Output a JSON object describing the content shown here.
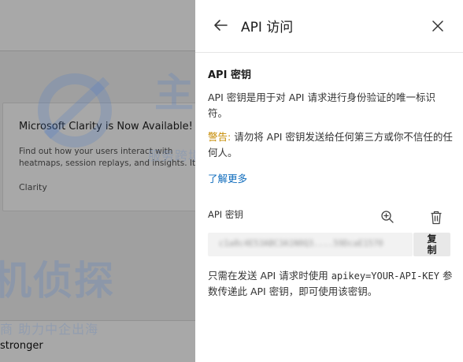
{
  "background": {
    "card": {
      "title": "Microsoft Clarity is Now Available!",
      "text_line1": "Find out how your users interact with",
      "text_line2": "heatmaps, session replays, and insights. It's",
      "link": "Clarity"
    },
    "bottom_text": "stronger"
  },
  "watermark": {
    "brand": "主机侦探",
    "brand_short": "机侦探",
    "tagline": "服务跨境电商 助力中企出海",
    "tagline_short": "商 助力中企出海",
    "tagline_right": "服务"
  },
  "panel": {
    "title": "API 访问",
    "back_icon": "arrow-left-icon",
    "close_icon": "close-icon",
    "section_title": "API 密钥",
    "description": "API 密钥是用于对 API 请求进行身份验证的唯一标识符。",
    "warning_label": "警告:",
    "warning_text": " 请勿将 API 密钥发送给任何第三方或你不信任的任何人。",
    "learn_more": "了解更多",
    "key_label": "API 密钥",
    "key_value": "c1a8c4E53ABC3A1N0Q3....59DcaE1570",
    "copy_label": "复制",
    "usage_prefix": "只需在发送 API 请求时使用 ",
    "usage_code": "apikey=YOUR-API-KEY",
    "usage_suffix": " 参数传递此 API 密钥，即可使用该密钥。",
    "colors": {
      "link": "#0f6cbd",
      "warning": "#c58a00"
    }
  }
}
